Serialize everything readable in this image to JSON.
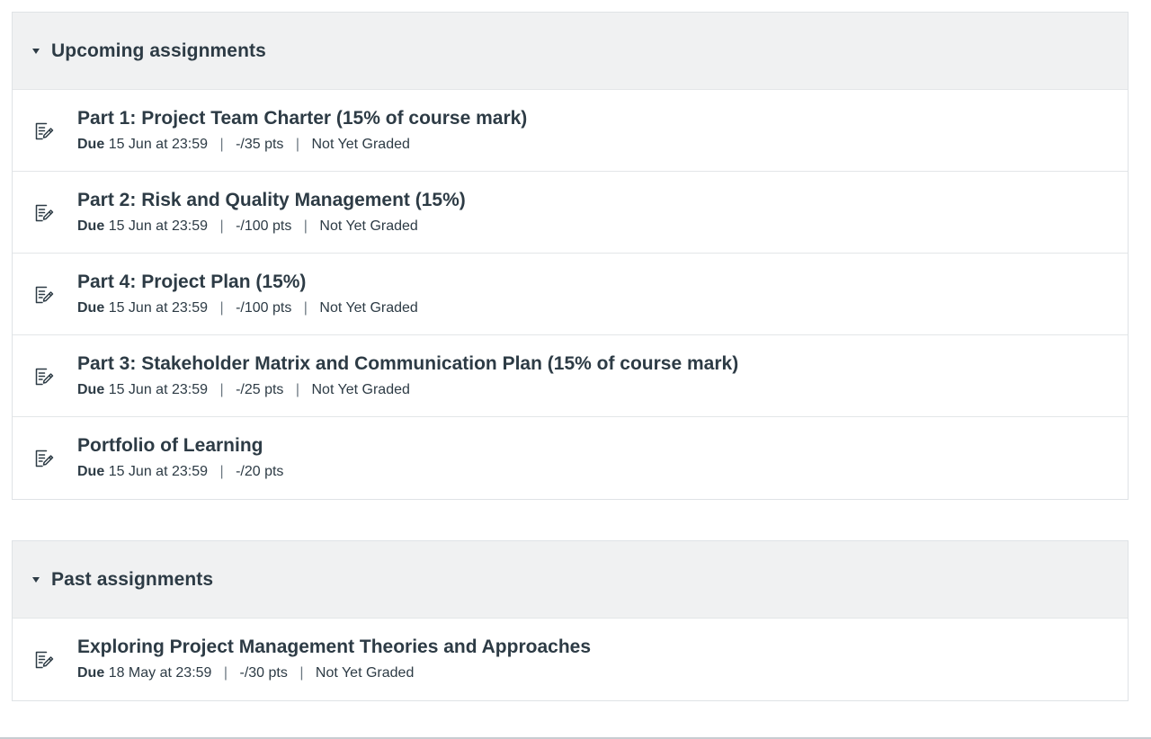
{
  "upcoming": {
    "title": "Upcoming assignments",
    "items": [
      {
        "title": "Part 1: Project Team Charter (15% of course mark)",
        "due_label": "Due",
        "due": "15 Jun at 23:59",
        "points": "-/35 pts",
        "status": "Not Yet Graded"
      },
      {
        "title": "Part 2: Risk and Quality Management (15%)",
        "due_label": "Due",
        "due": "15 Jun at 23:59",
        "points": "-/100 pts",
        "status": "Not Yet Graded"
      },
      {
        "title": "Part 4: Project Plan (15%)",
        "due_label": "Due",
        "due": "15 Jun at 23:59",
        "points": "-/100 pts",
        "status": "Not Yet Graded"
      },
      {
        "title": "Part 3: Stakeholder Matrix and Communication Plan (15% of course mark)",
        "due_label": "Due",
        "due": "15 Jun at 23:59",
        "points": "-/25 pts",
        "status": "Not Yet Graded"
      },
      {
        "title": "Portfolio of Learning",
        "due_label": "Due",
        "due": "15 Jun at 23:59",
        "points": "-/20 pts",
        "status": ""
      }
    ]
  },
  "past": {
    "title": "Past assignments",
    "items": [
      {
        "title": "Exploring Project Management Theories and Approaches",
        "due_label": "Due",
        "due": "18 May at 23:59",
        "points": "-/30 pts",
        "status": "Not Yet Graded"
      }
    ]
  },
  "icons": {
    "assignment": "assignment-icon",
    "collapse": "caret-down-icon"
  },
  "colors": {
    "text": "#2d3b45",
    "header_bg": "#f0f1f2",
    "border": "#dfe3e6"
  }
}
